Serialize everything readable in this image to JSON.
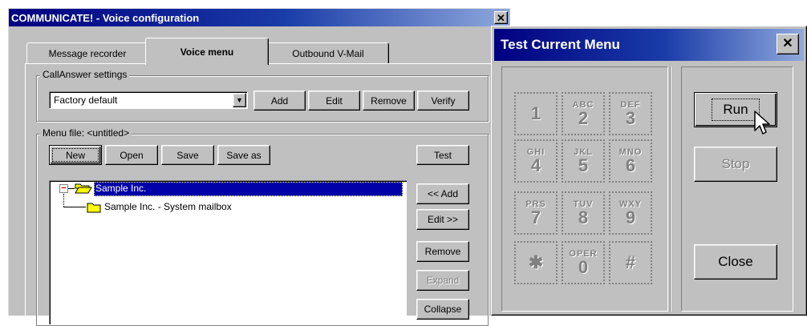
{
  "main_window": {
    "title": "COMMUNICATE! - Voice configuration",
    "close_glyph": "✕",
    "tabs": [
      {
        "label": "Message recorder",
        "active": false
      },
      {
        "label": "Voice menu",
        "active": true
      },
      {
        "label": "Outbound V-Mail",
        "active": false
      }
    ],
    "callanswer": {
      "group_label": "CallAnswer settings",
      "selected": "Factory default",
      "buttons": [
        "Add",
        "Edit",
        "Remove",
        "Verify"
      ]
    },
    "menu_file": {
      "group_label": "Menu file: <untitled>",
      "buttons": [
        "New",
        "Open",
        "Save",
        "Save as"
      ],
      "test_label": "Test",
      "side_buttons": [
        {
          "label": "<< Add",
          "disabled": false
        },
        {
          "label": "Edit >>",
          "disabled": false
        },
        {
          "label": "Remove",
          "disabled": false
        },
        {
          "label": "Expand",
          "disabled": true
        },
        {
          "label": "Collapse",
          "disabled": false
        }
      ],
      "tree": {
        "root": "Sample Inc.",
        "child": "Sample Inc. - System mailbox",
        "collapse_glyph": "−"
      }
    }
  },
  "test_window": {
    "title": "Test Current Menu",
    "close_glyph": "✕",
    "keypad": [
      {
        "digit": "1",
        "letters": ""
      },
      {
        "digit": "2",
        "letters": "ABC"
      },
      {
        "digit": "3",
        "letters": "DEF"
      },
      {
        "digit": "4",
        "letters": "GHI"
      },
      {
        "digit": "5",
        "letters": "JKL"
      },
      {
        "digit": "6",
        "letters": "MNO"
      },
      {
        "digit": "7",
        "letters": "PRS"
      },
      {
        "digit": "8",
        "letters": "TUV"
      },
      {
        "digit": "9",
        "letters": "WXY"
      },
      {
        "digit": "✱",
        "letters": ""
      },
      {
        "digit": "0",
        "letters": "OPER"
      },
      {
        "digit": "#",
        "letters": ""
      }
    ],
    "buttons": {
      "run": "Run",
      "stop": "Stop",
      "close": "Close"
    }
  },
  "colors": {
    "face": "#c0c0c0",
    "title_blue": "#000080",
    "selection": "#0000a8",
    "folder_yellow": "#ffff00"
  }
}
